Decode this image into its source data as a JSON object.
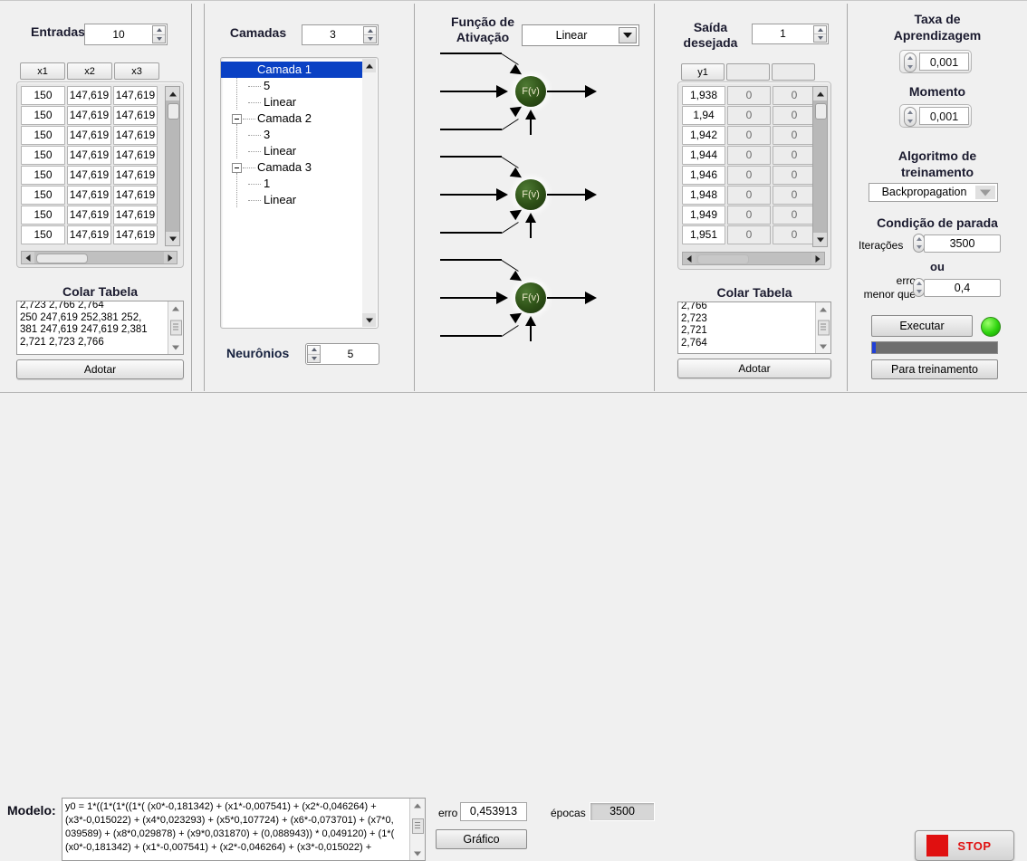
{
  "inputs_panel": {
    "title": "Entradas",
    "count": "10",
    "columns": [
      "x1",
      "x2",
      "x3"
    ],
    "rows": [
      [
        "150",
        "147,619",
        "147,619"
      ],
      [
        "150",
        "147,619",
        "147,619"
      ],
      [
        "150",
        "147,619",
        "147,619"
      ],
      [
        "150",
        "147,619",
        "147,619"
      ],
      [
        "150",
        "147,619",
        "147,619"
      ],
      [
        "150",
        "147,619",
        "147,619"
      ],
      [
        "150",
        "147,619",
        "147,619"
      ],
      [
        "150",
        "147,619",
        "147,619"
      ]
    ],
    "paste_title": "Colar Tabela",
    "paste_text": "2,723 2,766 2,764\n250 247,619 252,381 252,\n381 247,619 247,619 2,381\n2,721 2,723 2,766",
    "adopt_label": "Adotar"
  },
  "layers_panel": {
    "title": "Camadas",
    "count": "3",
    "tree": [
      {
        "name": "Camada 1",
        "neurons": "5",
        "activation": "Linear",
        "selected": true
      },
      {
        "name": "Camada 2",
        "neurons": "3",
        "activation": "Linear",
        "selected": false
      },
      {
        "name": "Camada 3",
        "neurons": "1",
        "activation": "Linear",
        "selected": false
      }
    ],
    "neurons_label": "Neurônios",
    "neurons_value": "5"
  },
  "activation_panel": {
    "title_line1": "Função de",
    "title_line2": "Ativação",
    "selected": "Linear",
    "neuron_label": "F(v)",
    "neuron_color": "#2d5016"
  },
  "output_panel": {
    "title_line1": "Saída",
    "title_line2": "desejada",
    "count": "1",
    "columns": [
      "y1",
      "",
      ""
    ],
    "rows": [
      [
        "1,938",
        "0",
        "0"
      ],
      [
        "1,94",
        "0",
        "0"
      ],
      [
        "1,942",
        "0",
        "0"
      ],
      [
        "1,944",
        "0",
        "0"
      ],
      [
        "1,946",
        "0",
        "0"
      ],
      [
        "1,948",
        "0",
        "0"
      ],
      [
        "1,949",
        "0",
        "0"
      ],
      [
        "1,951",
        "0",
        "0"
      ]
    ],
    "paste_title": "Colar Tabela",
    "paste_text": "2,766\n2,723\n2,721\n2,764",
    "adopt_label": "Adotar"
  },
  "training_panel": {
    "learning_rate_title_line1": "Taxa de",
    "learning_rate_title_line2": "Aprendizagem",
    "learning_rate_value": "0,001",
    "momentum_title": "Momento",
    "momentum_value": "0,001",
    "algorithm_title_line1": "Algoritmo de",
    "algorithm_title_line2": "treinamento",
    "algorithm_value": "Backpropagation",
    "stop_condition_title": "Condição de parada",
    "iterations_label": "Iterações",
    "iterations_value": "3500",
    "or_label": "ou",
    "error_label_line1": "erro",
    "error_label_line2": "menor que",
    "error_value": "0,4",
    "execute_label": "Executar",
    "stop_training_label": "Para treinamento",
    "led_color": "#2fd40f",
    "progress_percent": 3,
    "progress_color": "#2040d8"
  },
  "bottom_panel": {
    "model_label": "Modelo:",
    "model_text": "y0 = 1*((1*(1*((1*( (x0*-0,181342) + (x1*-0,007541) + (x2*-0,046264) +\n(x3*-0,015022) + (x4*0,023293) + (x5*0,107724) + (x6*-0,073701) + (x7*0,\n039589) + (x8*0,029878) + (x9*0,031870) + (0,088943)) * 0,049120) + (1*(\n(x0*-0,181342) + (x1*-0,007541) + (x2*-0,046264) + (x3*-0,015022) +",
    "graph_label": "Gráfico",
    "error_label": "erro",
    "error_value": "0,453913",
    "epochs_label": "épocas",
    "epochs_value": "3500",
    "stop_label": "STOP",
    "stop_color": "#e01010"
  }
}
